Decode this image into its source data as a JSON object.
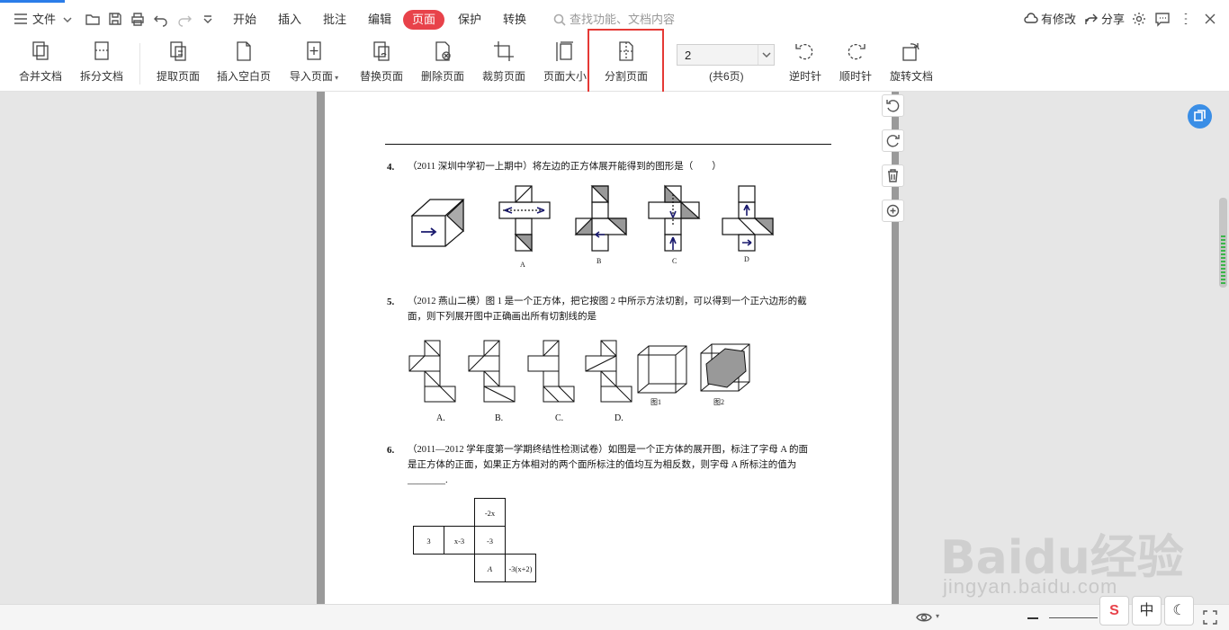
{
  "menubar": {
    "file_label": "文件",
    "tabs": [
      "开始",
      "插入",
      "批注",
      "编辑",
      "页面",
      "保护",
      "转换"
    ],
    "active_tab": "页面",
    "search_placeholder": "查找功能、文档内容",
    "modified_label": "有修改",
    "share_label": "分享"
  },
  "toolbar": {
    "buttons": [
      {
        "label": "合并文档",
        "icon": "merge-doc-icon"
      },
      {
        "label": "拆分文档",
        "icon": "split-doc-icon"
      },
      {
        "label": "提取页面",
        "icon": "extract-page-icon"
      },
      {
        "label": "插入空白页",
        "icon": "insert-blank-page-icon"
      },
      {
        "label": "导入页面",
        "icon": "import-page-icon"
      },
      {
        "label": "替换页面",
        "icon": "replace-page-icon"
      },
      {
        "label": "删除页面",
        "icon": "delete-page-icon"
      },
      {
        "label": "裁剪页面",
        "icon": "crop-page-icon"
      },
      {
        "label": "页面大小",
        "icon": "page-size-icon"
      },
      {
        "label": "分割页面",
        "icon": "split-page-icon"
      },
      {
        "label": "逆时针",
        "icon": "rotate-ccw-icon"
      },
      {
        "label": "顺时针",
        "icon": "rotate-cw-icon"
      },
      {
        "label": "旋转文档",
        "icon": "rotate-doc-icon"
      }
    ],
    "page_number": "2",
    "page_total": "(共6页)"
  },
  "document": {
    "q4": {
      "num": "4.",
      "text": "（2011 深圳中学初一上期中）将左边的正方体展开能得到的图形是（　　）",
      "options": [
        "A",
        "B",
        "C",
        "D"
      ]
    },
    "q5": {
      "num": "5.",
      "line1": "（2012 燕山二模）图 1 是一个正方体，把它按图 2 中所示方法切割，可以得到一个正六边形的截",
      "line2": "面，则下列展开图中正确画出所有切割线的是",
      "options": [
        "A.",
        "B.",
        "C.",
        "D."
      ],
      "fig1": "图1",
      "fig2": "图2"
    },
    "q6": {
      "num": "6.",
      "line1": "（2011—2012 学年度第一学期终结性检测试卷）如图是一个正方体的展开图，标注了字母 A 的面",
      "line2": "是正方体的正面，如果正方体相对的两个面所标注的值均互为相反数，则字母 A 所标注的值为",
      "line3": "________.",
      "cells": [
        "-2x",
        "3",
        "x-3",
        "-3",
        "A",
        "-3(x+2)"
      ]
    }
  },
  "status": {
    "ime_labels": [
      "S",
      "中",
      "☾"
    ]
  },
  "watermark": {
    "logo": "Baidu经验",
    "url": "jingyan.baidu.com"
  },
  "colors": {
    "accent_red": "#e8424a",
    "highlight_red": "#e53935",
    "blue": "#3a8ee6"
  }
}
